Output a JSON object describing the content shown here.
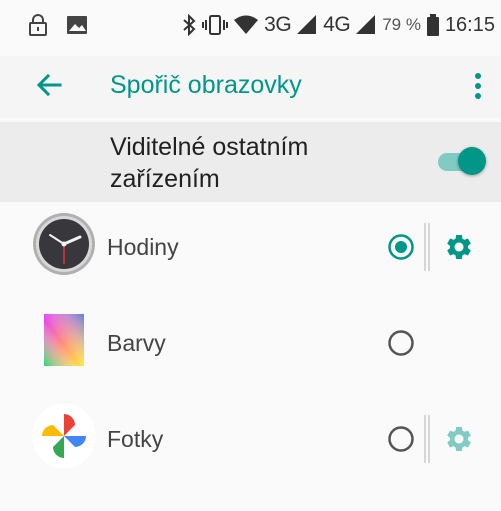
{
  "status": {
    "network_3g": "3G",
    "network_4g": "4G",
    "battery": "79 %",
    "time": "16:15"
  },
  "toolbar": {
    "title": "Spořič obrazovky"
  },
  "master": {
    "label_line1": "Viditelné ostatním",
    "label_line2": "zařízením",
    "enabled": true
  },
  "screensavers": [
    {
      "name": "Hodiny",
      "selected": true,
      "settings": true
    },
    {
      "name": "Barvy",
      "selected": false,
      "settings": false
    },
    {
      "name": "Fotky",
      "selected": false,
      "settings": true
    }
  ],
  "colors": {
    "accent": "#009688",
    "accent_light": "#80cbc4",
    "accent_faded": "#80cbc4"
  }
}
